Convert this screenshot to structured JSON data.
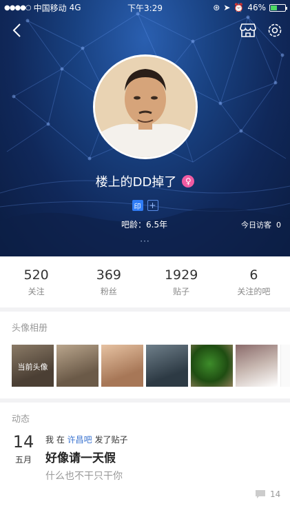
{
  "status_bar": {
    "carrier": "中国移动",
    "network": "4G",
    "time": "下午3:29",
    "battery": "46%",
    "battery_level": 0.46
  },
  "header": {
    "username": "楼上的DD掉了",
    "gender_symbol": "♀",
    "badge_seal": "印",
    "badge_add": "+",
    "ba_age_label": "吧龄：6.5年",
    "visitors_label": "今日访客",
    "visitors_count": "0",
    "more": "···"
  },
  "stats": [
    {
      "num": "520",
      "label": "关注"
    },
    {
      "num": "369",
      "label": "粉丝"
    },
    {
      "num": "1929",
      "label": "贴子"
    },
    {
      "num": "6",
      "label": "关注的吧"
    }
  ],
  "album": {
    "title": "头像相册",
    "current_caption": "当前头像"
  },
  "feed": {
    "title": "动态",
    "day": "14",
    "month": "五月",
    "meta_prefix": "我  在",
    "bar_name": "许昌吧",
    "meta_suffix": "发了贴子",
    "post_title": "好像请一天假",
    "post_body": "什么也不干只干你",
    "comment_count": "14"
  },
  "colors": {
    "hero_dark": "#0b1c40",
    "link_blue": "#3b74d0",
    "gender_pink": "#f05ba2",
    "badge_blue": "#2f7cf6"
  }
}
